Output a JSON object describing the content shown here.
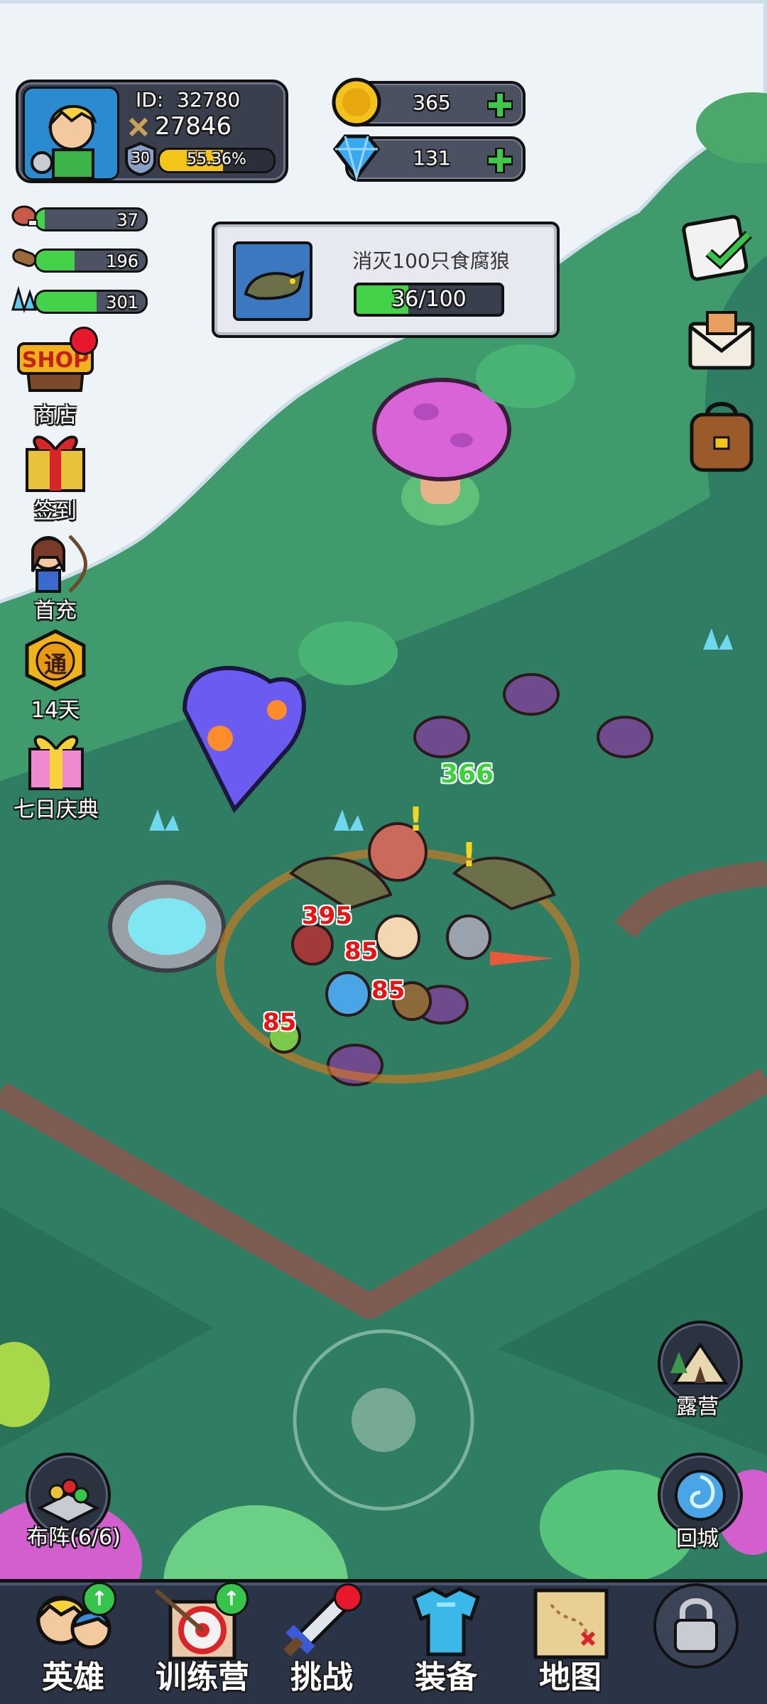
{
  "player": {
    "id_label": "ID:",
    "id_value": "32780",
    "power": "27846",
    "level": "30",
    "xp_percent_text": "55.36%",
    "xp_fraction": 0.5536
  },
  "currency": {
    "gold": "365",
    "diamond": "131"
  },
  "resources": [
    {
      "name": "meat-icon",
      "value": "37",
      "fill": 0.08
    },
    {
      "name": "wood-icon",
      "value": "196",
      "fill": 0.35
    },
    {
      "name": "crystal-icon",
      "value": "301",
      "fill": 0.55
    }
  ],
  "quest": {
    "title": "消灭100只食腐狼",
    "progress_text": "36/100",
    "progress_fraction": 0.36
  },
  "side_menu": {
    "shop_badge": "SHOP",
    "shop": "商店",
    "signin": "签到",
    "first_charge": "首充",
    "pass_badge": "通",
    "pass": "14天",
    "seven_day": "七日庆典"
  },
  "damage_numbers": [
    "366",
    "395",
    "85",
    "85",
    "85"
  ],
  "right_buttons": {
    "camp": "露营",
    "return_city": "回城"
  },
  "formation": "布阵(6/6)",
  "bottom_nav": {
    "heroes": "英雄",
    "training": "训练营",
    "challenge": "挑战",
    "equipment": "装备",
    "map": "地图"
  },
  "colors": {
    "grass": "#2f7d63",
    "snow": "#eef3f7",
    "progress_green": "#44d24a",
    "xp_yellow": "#f2c518",
    "badge_red": "#e8172b"
  }
}
